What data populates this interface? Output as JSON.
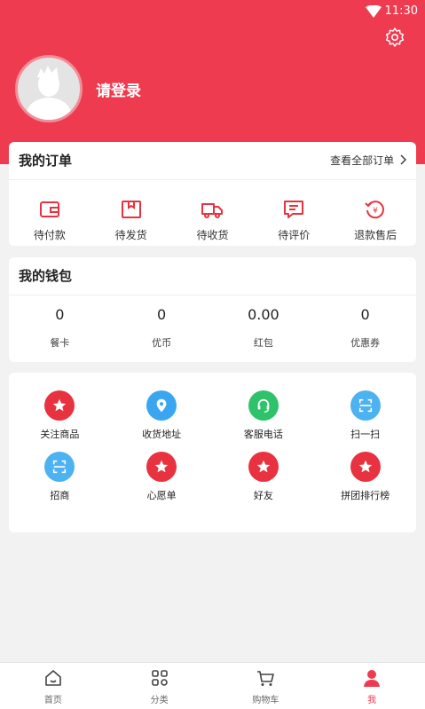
{
  "status": {
    "time": "11:30"
  },
  "profile": {
    "login_text": "请登录"
  },
  "orders": {
    "title": "我的订单",
    "view_all": "查看全部订单",
    "items": [
      {
        "label": "待付款",
        "icon": "wallet-icon"
      },
      {
        "label": "待发货",
        "icon": "package-icon"
      },
      {
        "label": "待收货",
        "icon": "truck-icon"
      },
      {
        "label": "待评价",
        "icon": "comment-icon"
      },
      {
        "label": "退款售后",
        "icon": "refund-icon"
      }
    ]
  },
  "wallet": {
    "title": "我的钱包",
    "items": [
      {
        "value": "0",
        "label": "餐卡"
      },
      {
        "value": "0",
        "label": "优币"
      },
      {
        "value": "0.00",
        "label": "红包"
      },
      {
        "value": "0",
        "label": "优惠券"
      }
    ]
  },
  "tools": [
    {
      "label": "关注商品",
      "icon": "star-icon",
      "color": "#e9323f"
    },
    {
      "label": "收货地址",
      "icon": "location-icon",
      "color": "#3ba6f0"
    },
    {
      "label": "客服电话",
      "icon": "headset-icon",
      "color": "#2ec26a"
    },
    {
      "label": "扫一扫",
      "icon": "scan-icon",
      "color": "#4db2f1"
    },
    {
      "label": "招商",
      "icon": "scan-icon",
      "color": "#4db2f1"
    },
    {
      "label": "心愿单",
      "icon": "star-icon",
      "color": "#e9323f"
    },
    {
      "label": "好友",
      "icon": "star-icon",
      "color": "#e9323f"
    },
    {
      "label": "拼团排行榜",
      "icon": "star-icon",
      "color": "#e9323f"
    }
  ],
  "tabbar": [
    {
      "label": "首页",
      "icon": "home-icon",
      "active": false
    },
    {
      "label": "分类",
      "icon": "category-icon",
      "active": false
    },
    {
      "label": "购物车",
      "icon": "cart-icon",
      "active": false
    },
    {
      "label": "我",
      "icon": "user-icon",
      "active": true
    }
  ],
  "colors": {
    "accent": "#ee3b4f",
    "background": "#f2f2f2"
  }
}
